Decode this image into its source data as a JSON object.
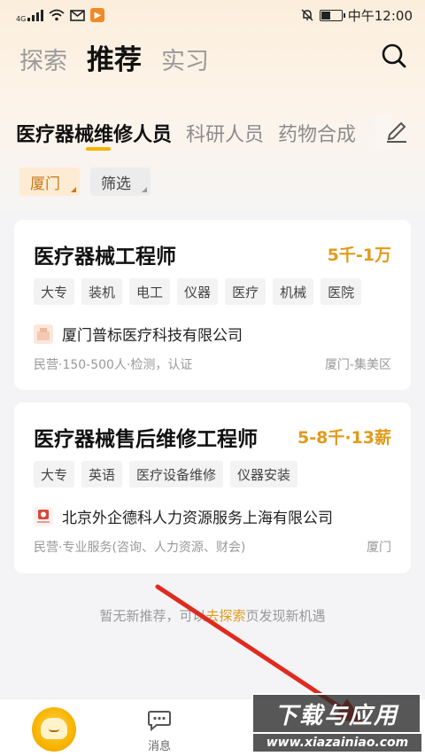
{
  "status_bar": {
    "network": "4G",
    "time": "中午12:00",
    "battery_level": 0.45
  },
  "header": {
    "tabs": [
      {
        "label": "探索",
        "active": false
      },
      {
        "label": "推荐",
        "active": true
      },
      {
        "label": "实习",
        "active": false
      }
    ],
    "search_icon": "search-icon"
  },
  "intent_tabs": [
    {
      "label": "医疗器械维修人员",
      "active": true
    },
    {
      "label": "科研人员",
      "active": false
    },
    {
      "label": "药物合成",
      "active": false
    }
  ],
  "filters": {
    "city": "厦门",
    "filter": "筛选"
  },
  "jobs": [
    {
      "title": "医疗器械工程师",
      "salary": "5千-1万",
      "tags": [
        "大专",
        "装机",
        "电工",
        "仪器",
        "医疗",
        "机械",
        "医院"
      ],
      "company": "厦门普标医疗科技有限公司",
      "meta": "民营·150-500人·检测，认证",
      "location": "厦门-集美区"
    },
    {
      "title": "医疗器械售后维修工程师",
      "salary": "5-8千·13薪",
      "tags": [
        "大专",
        "英语",
        "医疗设备维修",
        "仪器安装"
      ],
      "company": "北京外企德科人力资源服务上海有限公司",
      "meta": "民营·专业服务(咨询、人力资源、财会)",
      "location": "厦门"
    }
  ],
  "empty_tip": {
    "before": "暂无新推荐，可以",
    "link": "去探索",
    "after": "页发现新机遇"
  },
  "bottom_nav": {
    "messages_label": "消息"
  },
  "watermark": {
    "title": "下载与应用",
    "url": "www.xiazainiao.com"
  },
  "colors": {
    "accent": "#f5b400",
    "salary": "#e19a1b",
    "annotation_arrow": "#e02a1f"
  }
}
